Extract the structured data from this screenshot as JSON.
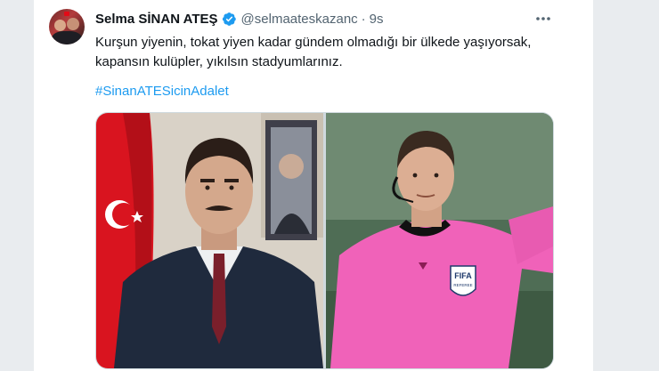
{
  "tweet": {
    "author_name": "Selma SİNAN ATEŞ",
    "handle": "@selmaateskazanc",
    "separator": "·",
    "time": "9s",
    "text": "Kurşun yiyenin, tokat yiyen kadar gündem olmadığı bir ülkede yaşıyorsak, kapansın kulüpler, yıkılsın stadyumlarınız.",
    "hashtag": "#SinanATESicinAdalet",
    "verified_color": "#1d9bf0",
    "hashtag_color": "#1d9bf0"
  },
  "media": {
    "images": [
      {
        "name": "photo-politician",
        "badge_text": ""
      },
      {
        "name": "photo-referee",
        "badge_text": "FIFA",
        "badge_subtext": "REFEREE"
      }
    ]
  }
}
